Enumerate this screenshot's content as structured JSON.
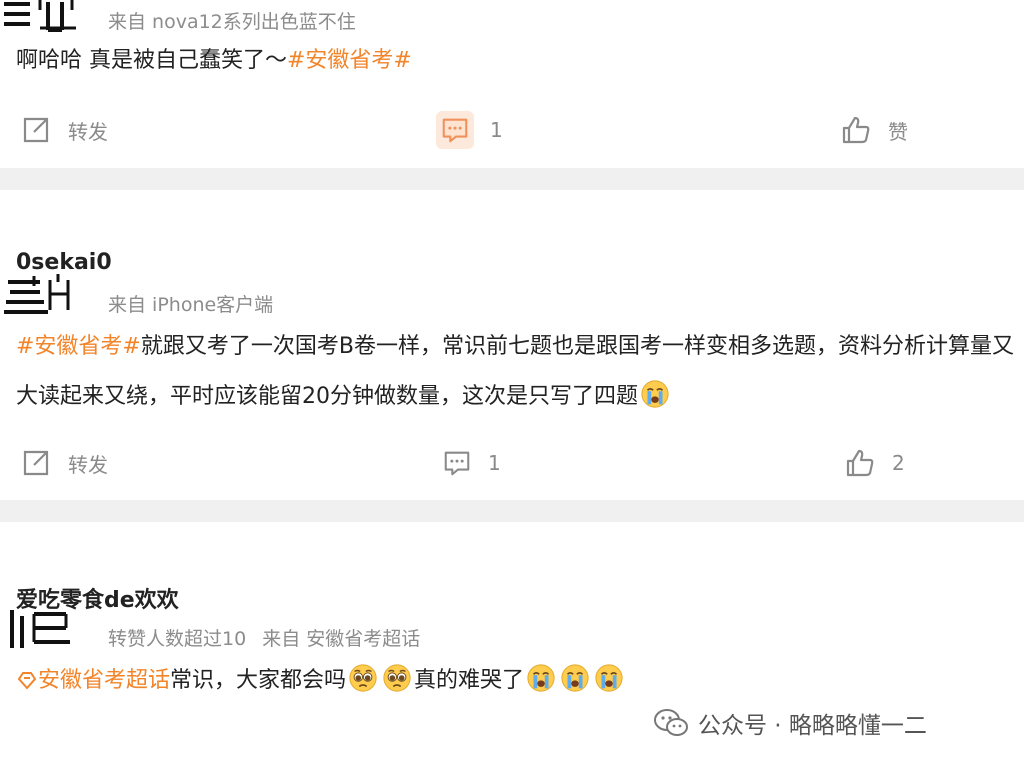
{
  "posts": [
    {
      "username": "",
      "meta": [
        "来自 nova12系列出色蓝不住"
      ],
      "segments": [
        {
          "text": "啊哈哈 真是被自己蠢笑了～",
          "topic": false
        },
        {
          "text": "#安徽省考#",
          "topic": true
        }
      ],
      "actions": {
        "repost_label": "转发",
        "comment_count": "1",
        "like_label": "赞"
      }
    },
    {
      "username": "0sekai0",
      "meta": [
        "来自 iPhone客户端"
      ],
      "segments": [
        {
          "text": "#安徽省考#",
          "topic": true
        },
        {
          "text": "就跟又考了一次国考B卷一样，常识前七题也是跟国考一样变相多选题，资料分析计算量又大读起来又绕，平时应该能留20分钟做数量，这次是只写了四题",
          "topic": false
        }
      ],
      "actions": {
        "repost_label": "转发",
        "comment_count": "1",
        "like_count": "2"
      }
    },
    {
      "username": "爱吃零食de欢欢",
      "meta": [
        "转赞人数超过10",
        "来自 安徽省考超话"
      ],
      "segments": [
        {
          "text": "安徽省考超话",
          "topic": true
        },
        {
          "text": "常识，大家都会吗",
          "topic": false
        },
        {
          "text": "真的难哭了",
          "topic": false
        }
      ]
    }
  ],
  "watermark": {
    "text": "公众号 · 略略略懂一二"
  },
  "icons": [
    "repost-icon",
    "comment-icon",
    "like-icon",
    "crying-emoji",
    "pleading-emoji",
    "supertopic-icon",
    "wechat-icon"
  ],
  "colors": {
    "topic": "#f2842a",
    "meta": "#8c8c8c",
    "separator": "#f0f0f0"
  }
}
